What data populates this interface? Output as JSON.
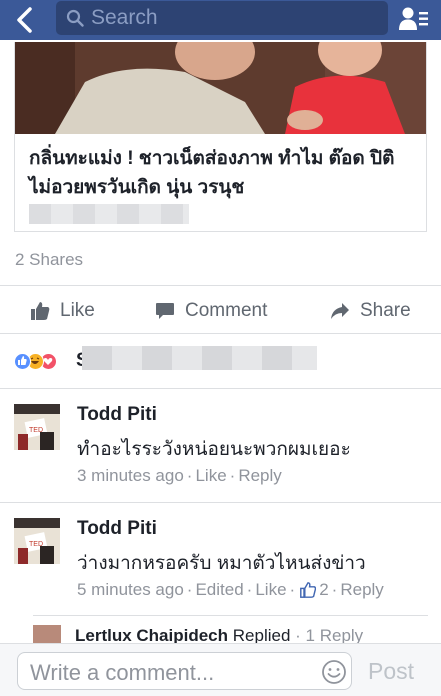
{
  "nav": {
    "search_placeholder": "Search"
  },
  "post": {
    "title": "กลิ่นทะแม่ง ! ชาวเน็ตส่องภาพ ทำไม ต๊อด ปิติ ไม่อวยพรวันเกิด นุ่น วรนุช",
    "shares": "2 Shares"
  },
  "actions": {
    "like": "Like",
    "comment": "Comment",
    "share": "Share"
  },
  "reactions": {
    "names_initial": "S"
  },
  "comments": [
    {
      "name": "Todd Piti",
      "text": "ทำอะไรระวังหน่อยนะพวกผมเยอะ",
      "time": "3 minutes ago",
      "like": "Like",
      "reply": "Reply"
    },
    {
      "name": "Todd Piti",
      "text": "ว่างมากหรอครับ หมาตัวไหนส่งข่าว",
      "time": "5 minutes ago",
      "edited": "Edited",
      "like": "Like",
      "like_count": "2",
      "reply": "Reply"
    }
  ],
  "reply_preview": {
    "name": "Lertlux Chaipidech",
    "action": "Replied",
    "count": "· 1 Reply"
  },
  "composer": {
    "placeholder": "Write a comment...",
    "post": "Post"
  },
  "colors": {
    "nav_blue": "#3b5998",
    "link_blue": "#4267b2",
    "meta_gray": "#90949c"
  }
}
